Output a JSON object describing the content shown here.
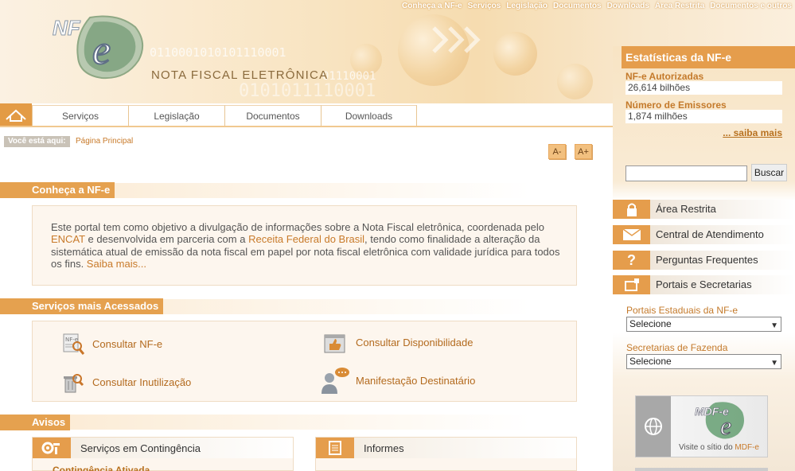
{
  "top_nav": [
    "Conheça a NF-e",
    "Serviços",
    "Legislação",
    "Documentos",
    "Downloads",
    "Área Restrita",
    "Documentos e outros"
  ],
  "header": {
    "logo_mark": "NF-e",
    "logo_text": "NOTA FISCAL ELETRÔNICA",
    "binary_1": "0110001010101110001",
    "binary_2": "01110001",
    "binary_3": "0101011110001"
  },
  "main_nav": [
    "Serviços",
    "Legislação",
    "Documentos",
    "Downloads"
  ],
  "breadcrumb": {
    "label": "Você está aqui:",
    "current": "Página Principal"
  },
  "font_controls": {
    "decrease": "A-",
    "increase": "A+"
  },
  "intro": {
    "title": "Conheça a NF-e",
    "text_1": "Este portal tem como objetivo a divulgação de informações sobre a Nota Fiscal eletrônica, coordenada pelo ",
    "link_1": "ENCAT",
    "text_2": " e desenvolvida em parceria com a ",
    "link_2": "Receita Federal do Brasil",
    "text_3": ", tendo como finalidade a alteração da sistemática atual de emissão da nota fiscal em papel por nota fiscal eletrônica com validade jurídica para todos os fins. ",
    "link_3": "Saiba mais..."
  },
  "services": {
    "title": "Serviços mais Acessados",
    "items": [
      {
        "label": "Consultar NF-e",
        "icon": "nfe-search-icon"
      },
      {
        "label": "Consultar Disponibilidade",
        "icon": "thumbs-up-icon"
      },
      {
        "label": "Consultar Inutilização",
        "icon": "trash-search-icon"
      },
      {
        "label": "Manifestação Destinatário",
        "icon": "user-chat-icon"
      }
    ]
  },
  "avisos": {
    "title": "Avisos",
    "boxes": [
      {
        "title": "Serviços em Contingência",
        "icon": "gear-icon",
        "first_item": "Contingência Ativada"
      },
      {
        "title": "Informes",
        "icon": "document-list-icon"
      }
    ]
  },
  "stats": {
    "title": "Estatísticas da NF-e",
    "authorized_label": "NF-e Autorizadas",
    "authorized_value": "26,614 bilhões",
    "issuers_label": "Número de Emissores",
    "issuers_value": "1,874 milhões",
    "more_link": "... saiba mais"
  },
  "search": {
    "placeholder": "",
    "button": "Buscar"
  },
  "sidebar_menu": [
    {
      "label": "Área Restrita",
      "icon": "lock-icon"
    },
    {
      "label": "Central de Atendimento",
      "icon": "mail-icon"
    },
    {
      "label": "Perguntas Frequentes",
      "icon": "question-icon"
    },
    {
      "label": "Portais e Secretarias",
      "icon": "window-icon"
    }
  ],
  "selects": {
    "portais_label": "Portais Estaduais da NF-e",
    "portais_value": "Selecione",
    "secretarias_label": "Secretarias de Fazenda",
    "secretarias_value": "Selecione"
  },
  "mdfe_banner": {
    "logo": "MDF-e",
    "text": "Visite o sítio do ",
    "link": "MDF-e"
  },
  "colors": {
    "accent": "#e59d4c",
    "link": "#c87a2a",
    "header_bg": "#f8e6c6"
  }
}
